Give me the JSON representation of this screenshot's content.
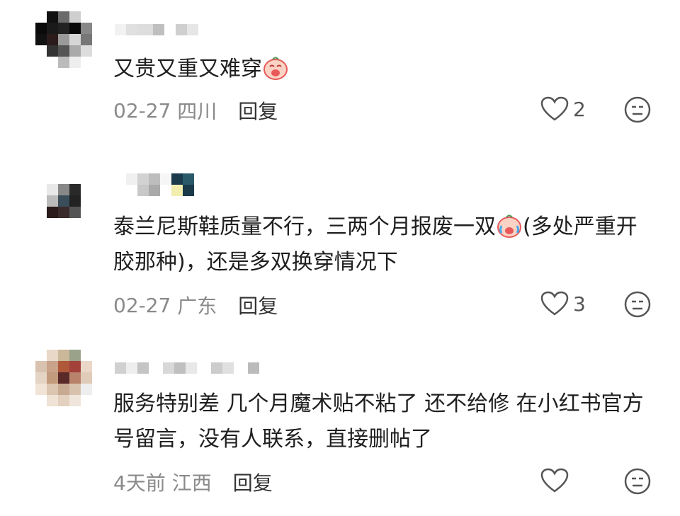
{
  "comments": [
    {
      "text": "又贵又重又难穿",
      "date": "02-27",
      "location": "四川",
      "reply_label": "回复",
      "like_count": "2",
      "emoji": "crying-face-icon"
    },
    {
      "text_part1": "泰兰尼斯鞋质量不行，三两个月报废一双",
      "text_part2": "(多处严重开胶那种)，还是多双换穿情况下",
      "date": "02-27",
      "location": "广东",
      "reply_label": "回复",
      "like_count": "3",
      "emoji": "crying-face-icon"
    },
    {
      "text": "服务特别差 几个月魔术贴不粘了 还不给修 在小红书官方号留言，没有人联系，直接删帖了",
      "date": "4天前",
      "location": "江西",
      "reply_label": "回复",
      "like_count": ""
    }
  ],
  "colors": {
    "text": "#1f1f1f",
    "meta": "#8a8a8a",
    "emoji_red": "#e85a5a"
  }
}
